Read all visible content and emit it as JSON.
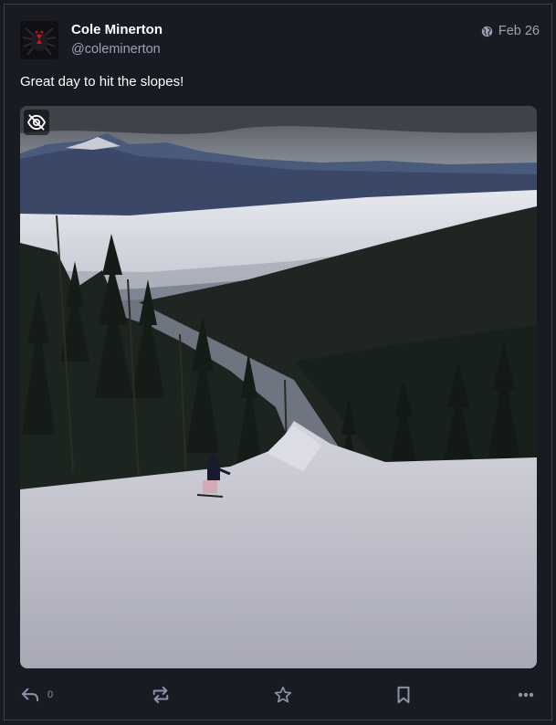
{
  "status": {
    "author": {
      "display_name": "Cole Minerton",
      "handle": "@coleminerton",
      "avatar_icon": "spider-avatar"
    },
    "visibility_icon": "globe-icon",
    "date": "Feb 26",
    "text": "Great day to hit the slopes!",
    "media": {
      "type": "photo",
      "description_icon": "eye-slash-icon"
    },
    "actions": {
      "reply_count": "0",
      "icons": [
        "reply-icon",
        "boost-icon",
        "favourite-icon",
        "bookmark-icon",
        "more-icon"
      ]
    }
  },
  "colors": {
    "background": "#191b22",
    "border": "#393f4f",
    "secondary_text": "#9ba3b8",
    "icon": "#8b93a8"
  }
}
